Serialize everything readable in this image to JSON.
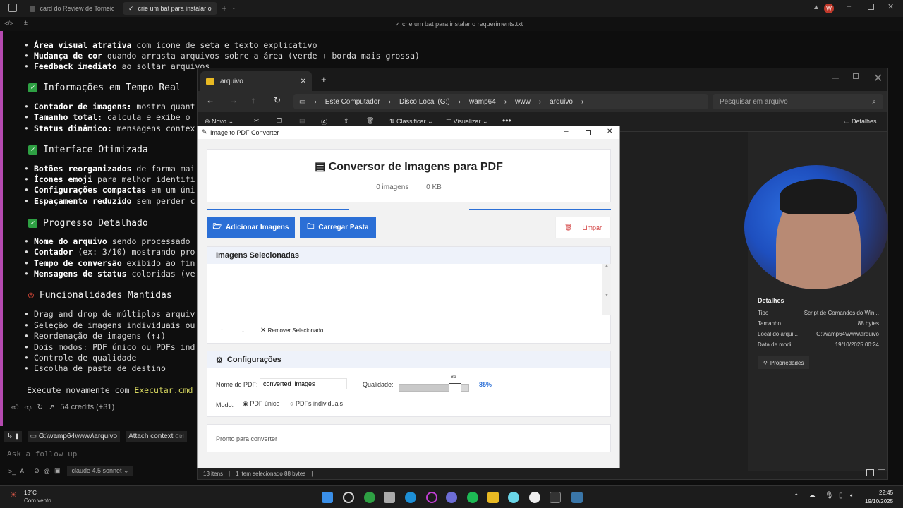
{
  "browser": {
    "tab1": "card do Review de Torneios",
    "tab2": "crie um bat para instalar o requ",
    "subtitle": "crie um bat para instalar o requeriments.txt"
  },
  "editor": {
    "line1_bold": "Área visual atrativa",
    "line1_rest": " com ícone de seta e texto explicativo",
    "line2_bold": "Mudança de cor",
    "line2_rest": " quando arrasta arquivos sobre a área (verde + borda mais grossa)",
    "line3_bold": "Feedback imediato",
    "line3_rest": " ao soltar arquivos",
    "h1": "Informações em Tempo Real",
    "l4_bold": "Contador de imagens:",
    "l4_rest": " mostra quant",
    "l5_bold": "Tamanho total:",
    "l5_rest": " calcula e exibe o",
    "l6_bold": "Status dinâmico:",
    "l6_rest": " mensagens contex",
    "h2": "Interface Otimizada",
    "l7_bold": "Botões reorganizados",
    "l7_rest": " de forma mai",
    "l8_bold": "Ícones emoji",
    "l8_rest": " para melhor identifi",
    "l9_bold": "Configurações compactas",
    "l9_rest": " em um úni",
    "l10_bold": "Espaçamento reduzido",
    "l10_rest": " sem perder c",
    "h3": "Progresso Detalhado",
    "l11_bold": "Nome do arquivo",
    "l11_rest": " sendo processado",
    "l12_bold": "Contador",
    "l12_rest": " (ex: 3/10) mostrando pro",
    "l13_bold": "Tempo de conversão",
    "l13_rest": " exibido ao fin",
    "l14_bold": "Mensagens de status",
    "l14_rest": " coloridas (ve",
    "h4": "Funcionalidades Mantidas",
    "l15": "Drag and drop de múltiplos arquiv",
    "l16": "Seleção de imagens individuais ou",
    "l17": "Reordenação de imagens (↑↓)",
    "l18": "Dois modos: PDF único ou PDFs ind",
    "l19": "Controle de qualidade",
    "l20": "Escolha de pasta de destino",
    "exec_pre": "Execute novamente com ",
    "exec_cmd": "Executar.cmd",
    "exec_post": " par",
    "credits": "54 credits (+31)",
    "path": "G:\\wamp64\\www\\arquivo",
    "attach": "Attach context",
    "attach_hint": "Ctrl",
    "followup_placeholder": "Ask a follow up",
    "model": "claude 4.5 sonnet"
  },
  "explorer": {
    "tab": "arquivo",
    "crumbs": [
      "Este Computador",
      "Disco Local (G:)",
      "wamp64",
      "www",
      "arquivo"
    ],
    "search_placeholder": "Pesquisar em arquivo",
    "new": "Novo",
    "sort": "Classificar",
    "view": "Visualizar",
    "details_btn": "Detalhes",
    "status_items": "13 itens",
    "status_selected": "1 item selecionado  88 bytes",
    "details": {
      "title": "Detalhes",
      "rows": [
        {
          "k": "Tipo",
          "v": "Script de Comandos do Win..."
        },
        {
          "k": "Tamanho",
          "v": "88 bytes"
        },
        {
          "k": "Local do arqui...",
          "v": "G:\\wamp64\\www\\arquivo"
        },
        {
          "k": "Data de modi...",
          "v": "19/10/2025 00:24"
        }
      ],
      "props": "Propriedades"
    }
  },
  "dialog": {
    "title": "Image to PDF Converter",
    "heading": "Conversor de Imagens para PDF",
    "count": "0 imagens",
    "size": "0 KB",
    "add_images": "Adicionar Imagens",
    "load_folder": "Carregar Pasta",
    "clear": "Limpar",
    "selected_title": "Imagens Selecionadas",
    "remove": "Remover Selecionado",
    "config_title": "Configurações",
    "pdf_name_label": "Nome do PDF:",
    "pdf_name_value": "converted_images",
    "quality_label": "Qualidade:",
    "quality_value": "85",
    "quality_pct": "85%",
    "quality_level": 0.85,
    "mode_label": "Modo:",
    "mode_single": "PDF único",
    "mode_multi": "PDFs individuais",
    "status": "Pronto para converter"
  },
  "taskbar": {
    "temp": "13°C",
    "weather": "Com vento",
    "time": "22:45",
    "date": "19/10/2025"
  },
  "colors": {
    "accent_blue": "#2b6fd6",
    "clear_red": "#d23b3b",
    "check_green": "#2ea043"
  }
}
